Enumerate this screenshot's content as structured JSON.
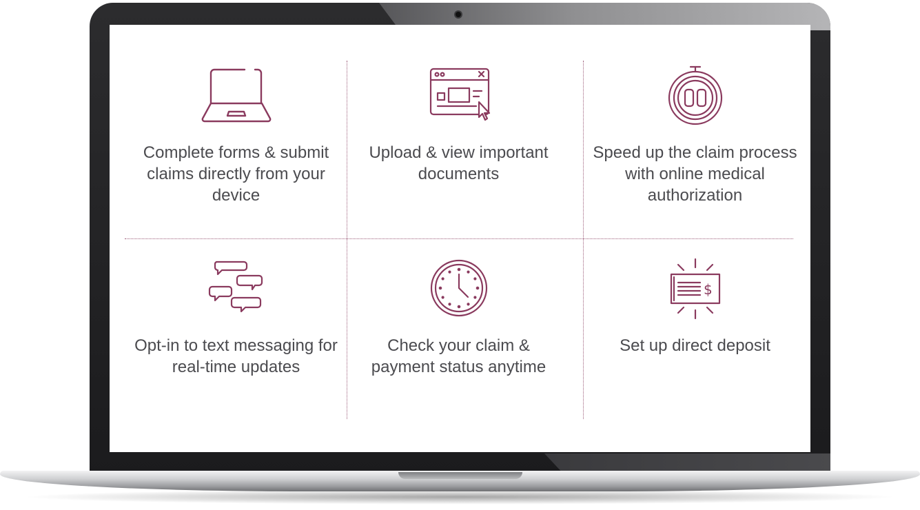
{
  "accent_color": "#8a3a5e",
  "features": [
    {
      "icon": "laptop-icon",
      "text": "Complete forms & submit claims directly from your device"
    },
    {
      "icon": "browser-window-icon",
      "text": "Upload & view important documents"
    },
    {
      "icon": "stopwatch-icon",
      "text": "Speed up the claim process with online medical authorization"
    },
    {
      "icon": "chat-bubbles-icon",
      "text": "Opt-in to text messaging for real-time updates"
    },
    {
      "icon": "clock-icon",
      "text": "Check your claim & payment status anytime"
    },
    {
      "icon": "check-deposit-icon",
      "text": "Set up direct deposit"
    }
  ]
}
